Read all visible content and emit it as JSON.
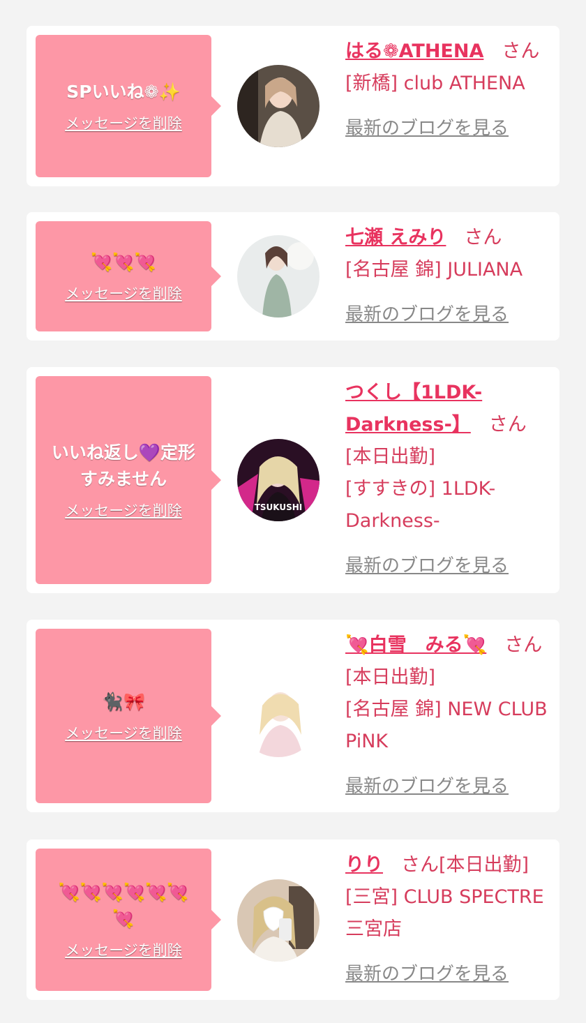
{
  "cards": [
    {
      "message": "SPいいね❁✨",
      "delete_label": "メッセージを削除",
      "name": "はる❁ATHENA",
      "suffix": "さん",
      "shop": "[新橋] club ATHENA",
      "blog_label": "最新のブログを見る"
    },
    {
      "message": "💘💘💘",
      "delete_label": "メッセージを削除",
      "name": "七瀬 えみり",
      "suffix": "さん",
      "shop": "[名古屋 錦] JULIANA",
      "blog_label": "最新のブログを見る"
    },
    {
      "message": "いいね返し💜定形\nすみません",
      "delete_label": "メッセージを削除",
      "name": "つくし【1LDK-Darkness-】",
      "suffix": "さん[本日出勤]",
      "shop": "[すすきの] 1LDK-Darkness-",
      "blog_label": "最新のブログを見る",
      "avatar_text": "TSUKUSHI"
    },
    {
      "message": "🐈‍⬛🎀",
      "delete_label": "メッセージを削除",
      "name": "💘白雪　みる💘",
      "suffix": "さん[本日出勤]",
      "shop": "[名古屋 錦] NEW CLUB PiNK",
      "blog_label": "最新のブログを見る"
    },
    {
      "message": "💘💘💘💘💘💘💘",
      "delete_label": "メッセージを削除",
      "name": "りり",
      "suffix": "さん[本日出勤]",
      "shop": "[三宮] CLUB SPECTRE 三宮店",
      "blog_label": "最新のブログを見る"
    }
  ]
}
